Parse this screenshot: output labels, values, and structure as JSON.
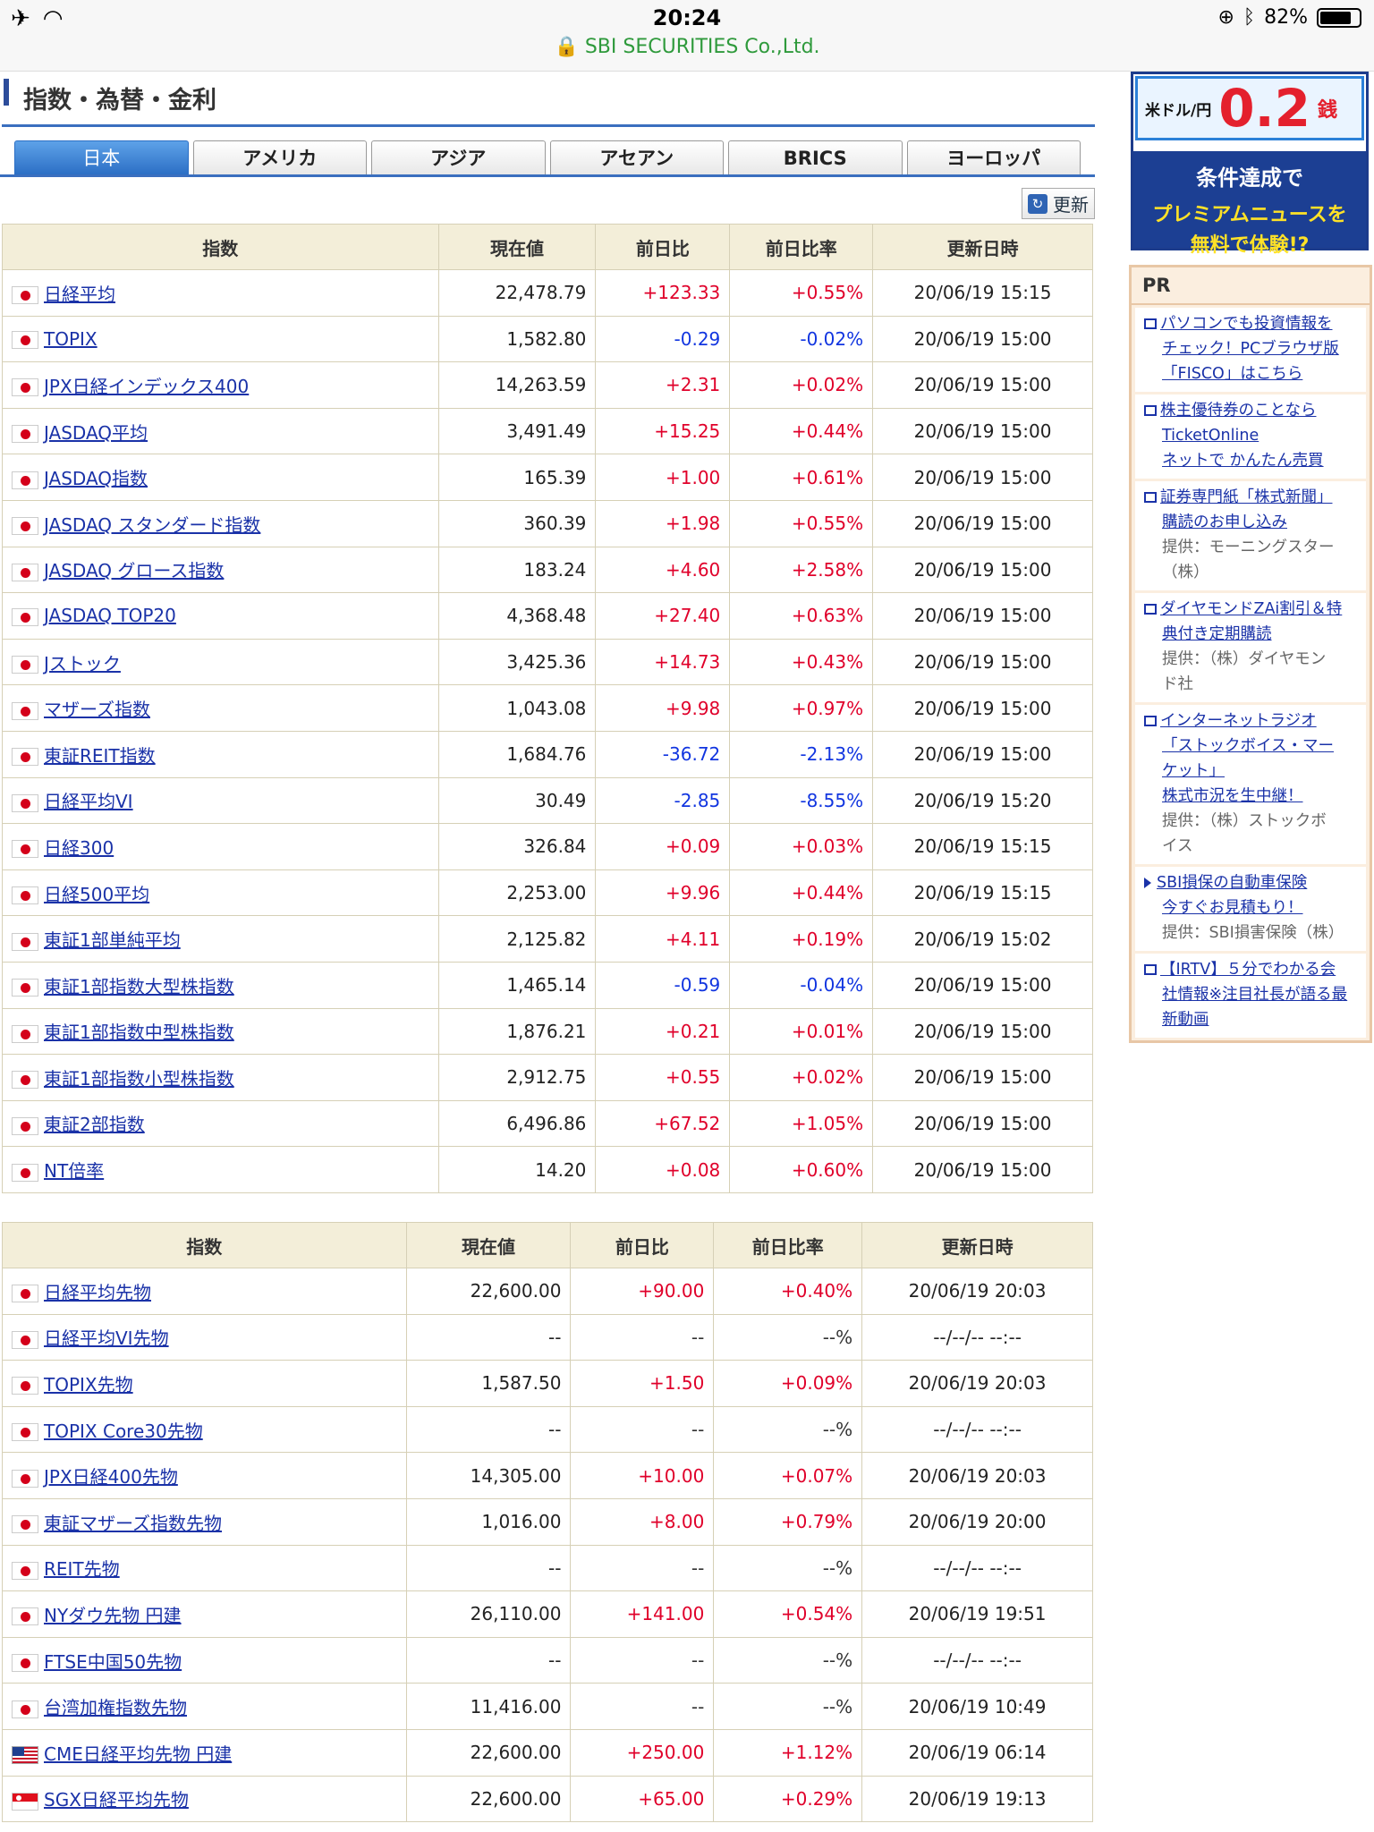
{
  "statusbar": {
    "time": "20:24",
    "url": "SBI SECURITIES Co.,Ltd.",
    "battery": "82%"
  },
  "section": {
    "title": "指数・為替・金利"
  },
  "tabs": [
    "日本",
    "アメリカ",
    "アジア",
    "アセアン",
    "BRICS",
    "ヨーロッパ"
  ],
  "refresh_label": "更新",
  "headers1": [
    "指数",
    "現在値",
    "前日比",
    "前日比率",
    "更新日時"
  ],
  "table1": [
    {
      "name": "日経平均",
      "price": "22,478.79",
      "chg": "+123.33",
      "pct": "+0.55%",
      "date": "20/06/19 15:15",
      "dir": "up"
    },
    {
      "name": "TOPIX",
      "price": "1,582.80",
      "chg": "-0.29",
      "pct": "-0.02%",
      "date": "20/06/19 15:00",
      "dir": "down"
    },
    {
      "name": "JPX日経インデックス400",
      "price": "14,263.59",
      "chg": "+2.31",
      "pct": "+0.02%",
      "date": "20/06/19 15:00",
      "dir": "up"
    },
    {
      "name": "JASDAQ平均",
      "price": "3,491.49",
      "chg": "+15.25",
      "pct": "+0.44%",
      "date": "20/06/19 15:00",
      "dir": "up"
    },
    {
      "name": "JASDAQ指数",
      "price": "165.39",
      "chg": "+1.00",
      "pct": "+0.61%",
      "date": "20/06/19 15:00",
      "dir": "up"
    },
    {
      "name": "JASDAQ スタンダード指数",
      "price": "360.39",
      "chg": "+1.98",
      "pct": "+0.55%",
      "date": "20/06/19 15:00",
      "dir": "up"
    },
    {
      "name": "JASDAQ グロース指数",
      "price": "183.24",
      "chg": "+4.60",
      "pct": "+2.58%",
      "date": "20/06/19 15:00",
      "dir": "up"
    },
    {
      "name": "JASDAQ TOP20",
      "price": "4,368.48",
      "chg": "+27.40",
      "pct": "+0.63%",
      "date": "20/06/19 15:00",
      "dir": "up"
    },
    {
      "name": "Jストック",
      "price": "3,425.36",
      "chg": "+14.73",
      "pct": "+0.43%",
      "date": "20/06/19 15:00",
      "dir": "up"
    },
    {
      "name": "マザーズ指数",
      "price": "1,043.08",
      "chg": "+9.98",
      "pct": "+0.97%",
      "date": "20/06/19 15:00",
      "dir": "up"
    },
    {
      "name": "東証REIT指数",
      "price": "1,684.76",
      "chg": "-36.72",
      "pct": "-2.13%",
      "date": "20/06/19 15:00",
      "dir": "down"
    },
    {
      "name": "日経平均VI",
      "price": "30.49",
      "chg": "-2.85",
      "pct": "-8.55%",
      "date": "20/06/19 15:20",
      "dir": "down"
    },
    {
      "name": "日経300",
      "price": "326.84",
      "chg": "+0.09",
      "pct": "+0.03%",
      "date": "20/06/19 15:15",
      "dir": "up"
    },
    {
      "name": "日経500平均",
      "price": "2,253.00",
      "chg": "+9.96",
      "pct": "+0.44%",
      "date": "20/06/19 15:15",
      "dir": "up"
    },
    {
      "name": "東証1部単純平均",
      "price": "2,125.82",
      "chg": "+4.11",
      "pct": "+0.19%",
      "date": "20/06/19 15:02",
      "dir": "up"
    },
    {
      "name": "東証1部指数大型株指数",
      "price": "1,465.14",
      "chg": "-0.59",
      "pct": "-0.04%",
      "date": "20/06/19 15:00",
      "dir": "down"
    },
    {
      "name": "東証1部指数中型株指数",
      "price": "1,876.21",
      "chg": "+0.21",
      "pct": "+0.01%",
      "date": "20/06/19 15:00",
      "dir": "up"
    },
    {
      "name": "東証1部指数小型株指数",
      "price": "2,912.75",
      "chg": "+0.55",
      "pct": "+0.02%",
      "date": "20/06/19 15:00",
      "dir": "up"
    },
    {
      "name": "東証2部指数",
      "price": "6,496.86",
      "chg": "+67.52",
      "pct": "+1.05%",
      "date": "20/06/19 15:00",
      "dir": "up"
    },
    {
      "name": "NT倍率",
      "price": "14.20",
      "chg": "+0.08",
      "pct": "+0.60%",
      "date": "20/06/19 15:00",
      "dir": "up"
    }
  ],
  "headers2": [
    "指数",
    "現在値",
    "前日比",
    "前日比率",
    "更新日時"
  ],
  "table2": [
    {
      "name": "日経平均先物",
      "price": "22,600.00",
      "chg": "+90.00",
      "pct": "+0.40%",
      "date": "20/06/19 20:03",
      "dir": "up",
      "flag": "jp"
    },
    {
      "name": "日経平均VI先物",
      "price": "--",
      "chg": "--",
      "pct": "--%",
      "date": "--/--/-- --:--",
      "dir": "flat",
      "flag": "jp"
    },
    {
      "name": "TOPIX先物",
      "price": "1,587.50",
      "chg": "+1.50",
      "pct": "+0.09%",
      "date": "20/06/19 20:03",
      "dir": "up",
      "flag": "jp"
    },
    {
      "name": "TOPIX Core30先物",
      "price": "--",
      "chg": "--",
      "pct": "--%",
      "date": "--/--/-- --:--",
      "dir": "flat",
      "flag": "jp"
    },
    {
      "name": "JPX日経400先物",
      "price": "14,305.00",
      "chg": "+10.00",
      "pct": "+0.07%",
      "date": "20/06/19 20:03",
      "dir": "up",
      "flag": "jp"
    },
    {
      "name": "東証マザーズ指数先物",
      "price": "1,016.00",
      "chg": "+8.00",
      "pct": "+0.79%",
      "date": "20/06/19 20:00",
      "dir": "up",
      "flag": "jp"
    },
    {
      "name": "REIT先物",
      "price": "--",
      "chg": "--",
      "pct": "--%",
      "date": "--/--/-- --:--",
      "dir": "flat",
      "flag": "jp"
    },
    {
      "name": "NYダウ先物 円建",
      "price": "26,110.00",
      "chg": "+141.00",
      "pct": "+0.54%",
      "date": "20/06/19 19:51",
      "dir": "up",
      "flag": "jp"
    },
    {
      "name": "FTSE中国50先物",
      "price": "--",
      "chg": "--",
      "pct": "--%",
      "date": "--/--/-- --:--",
      "dir": "flat",
      "flag": "jp"
    },
    {
      "name": "台湾加権指数先物",
      "price": "11,416.00",
      "chg": "--",
      "pct": "--%",
      "date": "20/06/19 10:49",
      "dir": "flat",
      "flag": "jp"
    },
    {
      "name": "CME日経平均先物 円建",
      "price": "22,600.00",
      "chg": "+250.00",
      "pct": "+1.12%",
      "date": "20/06/19 06:14",
      "dir": "up",
      "flag": "us"
    },
    {
      "name": "SGX日経平均先物",
      "price": "22,600.00",
      "chg": "+65.00",
      "pct": "+0.29%",
      "date": "20/06/19 19:13",
      "dir": "up",
      "flag": "sg"
    }
  ],
  "banner": {
    "label": "米ドル/円",
    "value": "0.2",
    "unit": "銭",
    "line1": "条件達成で",
    "line2a": "プレミアムニュースを",
    "line2b": "無料で体験!?"
  },
  "pr": {
    "title": "PR",
    "items": [
      {
        "icon": "box",
        "links": [
          "パソコンでも投資情報を",
          "チェック！PCブラウザ版",
          "「FISCO」はこちら"
        ],
        "provider": []
      },
      {
        "icon": "box",
        "links": [
          "株主優待券のことなら",
          "TicketOnline",
          "ネットで かんたん売買"
        ],
        "provider": []
      },
      {
        "icon": "box",
        "links": [
          "証券専門紙「株式新聞」",
          "購読のお申し込み"
        ],
        "provider": [
          "提供：モーニングスター",
          "（株）"
        ]
      },
      {
        "icon": "box",
        "links": [
          "ダイヤモンドZAi割引＆特",
          "典付き定期購読"
        ],
        "provider": [
          "提供：（株）ダイヤモン",
          "ド社"
        ]
      },
      {
        "icon": "box",
        "links": [
          "インターネットラジオ",
          "「ストックボイス・マー",
          "ケット」",
          "株式市況を生中継！"
        ],
        "provider": [
          "提供：（株）ストックボ",
          "イス"
        ]
      },
      {
        "icon": "tri",
        "links": [
          "SBI損保の自動車保険",
          "今すぐお見積もり！"
        ],
        "provider": [
          "提供：SBI損害保険（株）"
        ]
      },
      {
        "icon": "box",
        "links": [
          "【IRTV】５分でわかる会",
          "社情報※注目社長が語る最",
          "新動画"
        ],
        "provider": []
      }
    ]
  }
}
